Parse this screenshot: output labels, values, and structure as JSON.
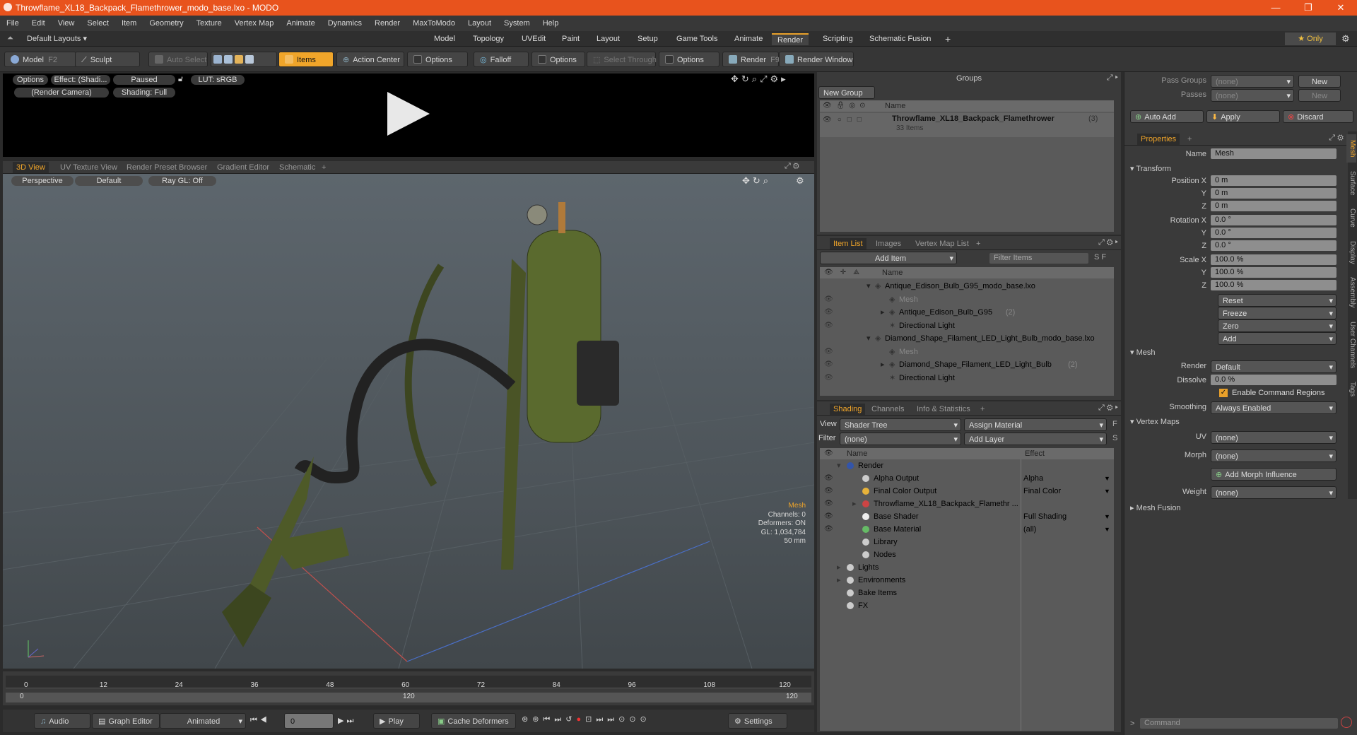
{
  "window": {
    "title": "Throwflame_XL18_Backpack_Flamethrower_modo_base.lxo - MODO",
    "minimize": "—",
    "maximize": "❐",
    "close": "✕"
  },
  "menu": [
    "File",
    "Edit",
    "View",
    "Select",
    "Item",
    "Geometry",
    "Texture",
    "Vertex Map",
    "Animate",
    "Dynamics",
    "Render",
    "MaxToModo",
    "Layout",
    "System",
    "Help"
  ],
  "layouts": {
    "label": "Default Layouts ▾",
    "tabs": [
      "Model",
      "Topology",
      "UVEdit",
      "Paint",
      "Layout",
      "Setup",
      "Game Tools",
      "Animate",
      "Render",
      "Scripting",
      "Schematic Fusion"
    ],
    "active": "Render",
    "add": "+",
    "only": "★ Only",
    "gear": "⚙"
  },
  "toolbar": {
    "model": "Model",
    "model_key": "F2",
    "sculpt": "Sculpt",
    "auto_select": "Auto Select",
    "items": "Items",
    "action_center": "Action Center",
    "options1": "Options",
    "falloff": "Falloff",
    "options2": "Options",
    "select_through": "Select Through",
    "options3": "Options",
    "render": "Render",
    "render_key": "F9",
    "render_window": "Render Window"
  },
  "preview": {
    "options": "Options",
    "effect": "Effect: (Shadi...",
    "paused": "Paused",
    "lut": "LUT: sRGB",
    "camera": "(Render Camera)",
    "shading": "Shading: Full"
  },
  "viewtabs": {
    "tabs": [
      "3D View",
      "UV Texture View",
      "Render Preset Browser",
      "Gradient Editor",
      "Schematic"
    ],
    "add": "+",
    "perspective": "Perspective",
    "default": "Default",
    "raygl": "Ray GL: Off"
  },
  "hud": {
    "mesh": "Mesh",
    "channels": "Channels: 0",
    "deformers": "Deformers: ON",
    "gl": "GL: 1,034,784",
    "mm": "50 mm"
  },
  "timeline": {
    "ticks": [
      "0",
      "12",
      "24",
      "36",
      "48",
      "60",
      "72",
      "84",
      "96",
      "108",
      "120"
    ],
    "sub_start": "0",
    "sub_mid": "120",
    "sub_end": "120"
  },
  "bottom": {
    "audio": "Audio",
    "graph_editor": "Graph Editor",
    "animated": "Animated",
    "frame": "0",
    "play": "Play",
    "cache": "Cache Deformers",
    "settings": "Settings"
  },
  "groups": {
    "title": "Groups",
    "new_group": "New Group",
    "col_name": "Name",
    "item_name": "Throwflame_XL18_Backpack_Flamethrower",
    "item_count": "(3)",
    "item_sub": "33 Items"
  },
  "itemlist": {
    "tabs": [
      "Item List",
      "Images",
      "Vertex Map List"
    ],
    "add": "+",
    "add_item": "Add Item",
    "filter": "Filter Items",
    "col_name": "Name",
    "rows": [
      {
        "indent": 0,
        "arrow": "▾",
        "text": "Antique_Edison_Bulb_G95_modo_base.lxo",
        "extra": "",
        "grey": false
      },
      {
        "indent": 1,
        "arrow": "",
        "text": "Mesh",
        "extra": "",
        "grey": true
      },
      {
        "indent": 1,
        "arrow": "▸",
        "text": "Antique_Edison_Bulb_G95",
        "extra": "(2)",
        "grey": false
      },
      {
        "indent": 1,
        "arrow": "",
        "text": "Directional Light",
        "extra": "",
        "grey": false
      },
      {
        "indent": 0,
        "arrow": "▾",
        "text": "Diamond_Shape_Filament_LED_Light_Bulb_modo_base.lxo",
        "extra": "",
        "grey": false
      },
      {
        "indent": 1,
        "arrow": "",
        "text": "Mesh",
        "extra": "",
        "grey": true
      },
      {
        "indent": 1,
        "arrow": "▸",
        "text": "Diamond_Shape_Filament_LED_Light_Bulb",
        "extra": "(2)",
        "grey": false
      },
      {
        "indent": 1,
        "arrow": "",
        "text": "Directional Light",
        "extra": "",
        "grey": false
      }
    ]
  },
  "shading": {
    "tabs": [
      "Shading",
      "Channels",
      "Info & Statistics"
    ],
    "add": "+",
    "view_label": "View",
    "view": "Shader Tree",
    "assign": "Assign Material",
    "filter_label": "Filter",
    "filter": "(none)",
    "add_layer": "Add Layer",
    "col_name": "Name",
    "col_effect": "Effect",
    "rows": [
      {
        "indent": 0,
        "arrow": "▾",
        "text": "Render",
        "effect": "",
        "eye": false
      },
      {
        "indent": 1,
        "arrow": "",
        "text": "Alpha Output",
        "effect": "Alpha",
        "eye": true
      },
      {
        "indent": 1,
        "arrow": "",
        "text": "Final Color Output",
        "effect": "Final Color",
        "eye": true
      },
      {
        "indent": 1,
        "arrow": "▸",
        "text": "Throwflame_XL18_Backpack_Flamethr ...",
        "effect": "",
        "eye": true
      },
      {
        "indent": 1,
        "arrow": "",
        "text": "Base Shader",
        "effect": "Full Shading",
        "eye": true
      },
      {
        "indent": 1,
        "arrow": "",
        "text": "Base Material",
        "effect": "(all)",
        "eye": true
      },
      {
        "indent": 1,
        "arrow": "",
        "text": "Library",
        "effect": "",
        "eye": false
      },
      {
        "indent": 1,
        "arrow": "",
        "text": "Nodes",
        "effect": "",
        "eye": false
      },
      {
        "indent": 0,
        "arrow": "▸",
        "text": "Lights",
        "effect": "",
        "eye": false
      },
      {
        "indent": 0,
        "arrow": "▸",
        "text": "Environments",
        "effect": "",
        "eye": false
      },
      {
        "indent": 0,
        "arrow": "",
        "text": "Bake Items",
        "effect": "",
        "eye": false
      },
      {
        "indent": 0,
        "arrow": "",
        "text": "FX",
        "effect": "",
        "eye": false
      }
    ]
  },
  "props": {
    "pass_groups_label": "Pass Groups",
    "pass_groups": "(none)",
    "new": "New",
    "passes_label": "Passes",
    "passes": "(none)",
    "new2": "New",
    "auto_add": "Auto Add",
    "apply": "Apply",
    "discard": "Discard",
    "tab": "Properties",
    "add": "+",
    "name_label": "Name",
    "name": "Mesh",
    "transform": "Transform",
    "pos_x_label": "Position X",
    "pos_x": "0 m",
    "pos_y_label": "Y",
    "pos_y": "0 m",
    "pos_z_label": "Z",
    "pos_z": "0 m",
    "rot_x_label": "Rotation X",
    "rot_x": "0.0 °",
    "rot_y_label": "Y",
    "rot_y": "0.0 °",
    "rot_z_label": "Z",
    "rot_z": "0.0 °",
    "scl_x_label": "Scale X",
    "scl_x": "100.0 %",
    "scl_y_label": "Y",
    "scl_y": "100.0 %",
    "scl_z_label": "Z",
    "scl_z": "100.0 %",
    "reset": "Reset",
    "freeze": "Freeze",
    "zero": "Zero",
    "add_btn": "Add",
    "mesh": "Mesh",
    "render_label": "Render",
    "render": "Default",
    "dissolve_label": "Dissolve",
    "dissolve": "0.0 %",
    "enable_cmd": "Enable Command Regions",
    "smoothing_label": "Smoothing",
    "smoothing": "Always Enabled",
    "vertex_maps": "Vertex Maps",
    "uv_label": "UV",
    "uv": "(none)",
    "morph_label": "Morph",
    "morph": "(none)",
    "add_morph": "Add Morph Influence",
    "weight_label": "Weight",
    "weight": "(none)",
    "mesh_fusion": "Mesh Fusion",
    "side_tabs": [
      "Mesh",
      "Surface",
      "Curve",
      "Display",
      "Assembly",
      "User Channels",
      "Tags"
    ],
    "command": "Command"
  }
}
